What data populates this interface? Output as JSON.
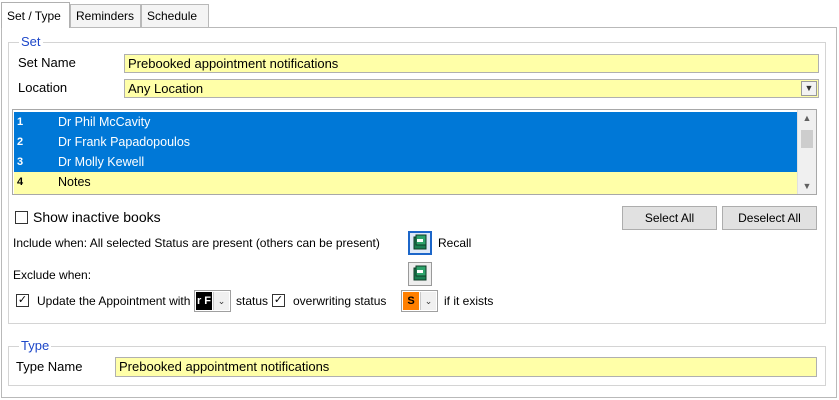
{
  "tabs": [
    {
      "label": "Set / Type",
      "active": true
    },
    {
      "label": "Reminders",
      "active": false
    },
    {
      "label": "Schedule",
      "active": false
    }
  ],
  "set_group": {
    "legend": "Set",
    "set_name_label": "Set Name",
    "set_name_value": "Prebooked appointment notifications",
    "location_label": "Location",
    "location_value": "Any Location",
    "books": [
      {
        "num": "1",
        "name": "Dr Phil McCavity",
        "selected": true
      },
      {
        "num": "2",
        "name": "Dr Frank Papadopoulos",
        "selected": true
      },
      {
        "num": "3",
        "name": "Dr Molly Kewell",
        "selected": true
      },
      {
        "num": "4",
        "name": "Notes",
        "selected": true
      }
    ],
    "show_inactive_label": "Show inactive books",
    "show_inactive_checked": false,
    "select_all_label": "Select All",
    "deselect_all_label": "Deselect All",
    "include_when_label": "Include when: All selected Status are present (others can be present)",
    "recall_label": "Recall",
    "exclude_when_label": "Exclude when:",
    "update_label": "Update the Appointment with",
    "update_checked": true,
    "update_status_code": "r F",
    "update_status_color": "#000000",
    "status_label": "status",
    "overwriting_label": "overwriting status",
    "overwriting_checked": true,
    "overwrite_status_code": "S",
    "overwrite_status_color": "#ff7f00",
    "if_exists_label": "if it exists"
  },
  "type_group": {
    "legend": "Type",
    "type_name_label": "Type Name",
    "type_name_value": "Prebooked appointment notifications"
  },
  "colors": {
    "field_yellow": "#ffffa8",
    "selection_blue": "#0078d7",
    "legend_blue": "#1d47c9"
  }
}
